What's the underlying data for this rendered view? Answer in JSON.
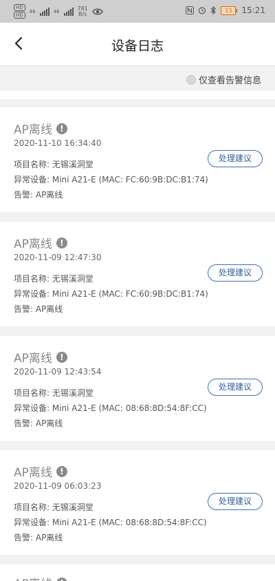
{
  "status_bar": {
    "net1": "46",
    "net2": "46",
    "speed_value": "781",
    "speed_unit": "B/s",
    "battery": "13",
    "time": "15:21"
  },
  "header": {
    "title": "设备日志"
  },
  "filter": {
    "only_alarm_label": "仅查看告警信息"
  },
  "logs": [
    {
      "title": "AP离线",
      "time": "2020-11-10 16:34:40",
      "project": "项目名称: 无锡溪洞堂",
      "device": "异常设备: Mini A21-E (MAC: FC:60:9B:DC:B1:74)",
      "alarm": "告警: AP离线",
      "action": "处理建议"
    },
    {
      "title": "AP离线",
      "time": "2020-11-09 12:47:30",
      "project": "项目名称: 无锡溪洞堂",
      "device": "异常设备: Mini A21-E (MAC: FC:60:9B:DC:B1:74)",
      "alarm": "告警: AP离线",
      "action": "处理建议"
    },
    {
      "title": "AP离线",
      "time": "2020-11-09 12:43:54",
      "project": "项目名称: 无锡溪洞堂",
      "device": "异常设备: Mini A21-E (MAC: 08:68:8D:54:8F:CC)",
      "alarm": "告警: AP离线",
      "action": "处理建议"
    },
    {
      "title": "AP离线",
      "time": "2020-11-09 06:03:23",
      "project": "项目名称: 无锡溪洞堂",
      "device": "异常设备: Mini A21-E (MAC: 08:68:8D:54:8F:CC)",
      "alarm": "告警: AP离线",
      "action": "处理建议"
    },
    {
      "title": "AP离线"
    }
  ]
}
